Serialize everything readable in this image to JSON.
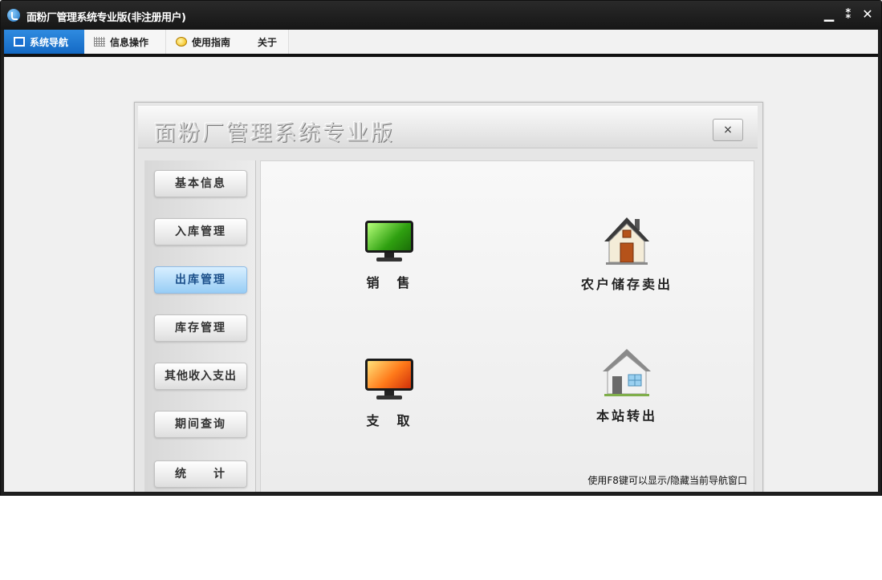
{
  "window": {
    "title": "面粉厂管理系统专业版(非注册用户)",
    "controls": {
      "minimize": "▁",
      "restore": "⁑",
      "close": "✕"
    }
  },
  "menu": {
    "tabs": [
      {
        "label": "系统导航",
        "icon": "monitor-icon",
        "active": true
      },
      {
        "label": "信息操作",
        "icon": "grid-icon",
        "active": false
      },
      {
        "label": "使用指南",
        "icon": "guide-icon",
        "active": false
      },
      {
        "label": "关于",
        "icon": "",
        "active": false
      }
    ]
  },
  "nav_panel": {
    "title": "面粉厂管理系统专业版",
    "close_label": "×",
    "sidebar": [
      {
        "label": "基本信息",
        "active": false
      },
      {
        "label": "入库管理",
        "active": false
      },
      {
        "label": "出库管理",
        "active": true
      },
      {
        "label": "库存管理",
        "active": false
      },
      {
        "label": "其他收入支出",
        "active": false
      },
      {
        "label": "期间查询",
        "active": false
      },
      {
        "label": "统　　计",
        "active": false
      }
    ],
    "tiles": [
      {
        "label": "销　售",
        "icon": "green-monitor-icon"
      },
      {
        "label": "农户储存卖出",
        "icon": "brown-house-icon"
      },
      {
        "label": "支　取",
        "icon": "orange-monitor-icon"
      },
      {
        "label": "本站转出",
        "icon": "gray-house-icon"
      }
    ],
    "hint": "使用F8键可以显示/隐藏当前导航窗口"
  },
  "colors": {
    "accent": "#1a73d0",
    "active_side": "#98cdf5"
  }
}
